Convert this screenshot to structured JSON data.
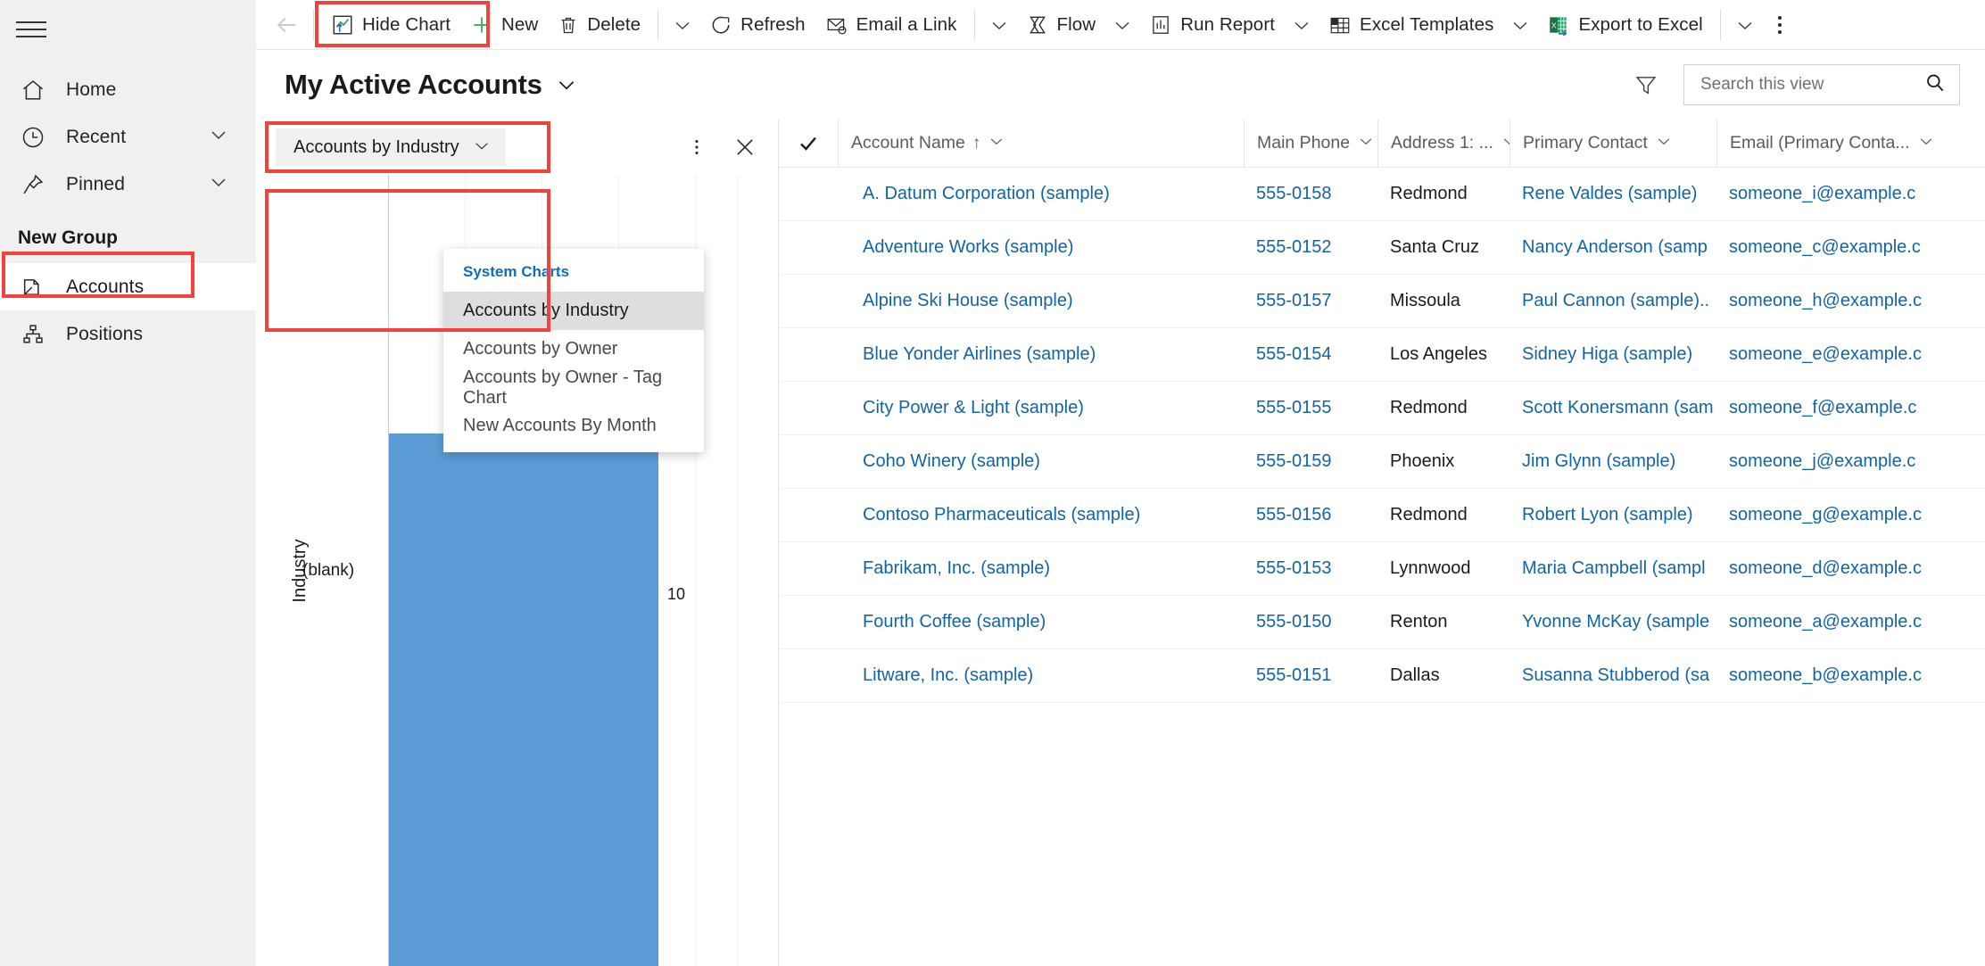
{
  "sidebar": {
    "menu_icon": "hamburger-icon",
    "items": [
      {
        "label": "Home",
        "icon": "home-icon",
        "chevron": false
      },
      {
        "label": "Recent",
        "icon": "clock-icon",
        "chevron": true
      },
      {
        "label": "Pinned",
        "icon": "pin-icon",
        "chevron": true
      }
    ],
    "group_title": "New Group",
    "group_items": [
      {
        "label": "Accounts",
        "icon": "accounts-icon",
        "selected": true
      },
      {
        "label": "Positions",
        "icon": "positions-icon",
        "selected": false
      }
    ]
  },
  "commandbar": {
    "back": "back-arrow-icon",
    "items": [
      {
        "label": "Hide Chart",
        "icon": "chart-icon",
        "chevron": false,
        "divider_after": false
      },
      {
        "label": "New",
        "icon": "plus-icon",
        "chevron": false,
        "divider_after": false
      },
      {
        "label": "Delete",
        "icon": "trash-icon",
        "chevron": true,
        "divider_after": true
      },
      {
        "label": "Refresh",
        "icon": "refresh-icon",
        "chevron": false,
        "divider_after": false
      },
      {
        "label": "Email a Link",
        "icon": "email-link-icon",
        "chevron": true,
        "divider_after": true
      },
      {
        "label": "Flow",
        "icon": "flow-icon",
        "chevron": true,
        "divider_after": false
      },
      {
        "label": "Run Report",
        "icon": "run-report-icon",
        "chevron": true,
        "divider_after": false
      },
      {
        "label": "Excel Templates",
        "icon": "excel-template-icon",
        "chevron": true,
        "divider_after": false
      },
      {
        "label": "Export to Excel",
        "icon": "export-excel-icon",
        "chevron": true,
        "divider_after": true
      }
    ],
    "overflow": "more-options-icon"
  },
  "view_header": {
    "title": "My Active Accounts",
    "filter_icon": "filter-icon",
    "search": {
      "placeholder": "Search this view",
      "value": "",
      "icon": "search-icon"
    }
  },
  "chart_panel": {
    "selector_label": "Accounts by Industry",
    "more_icon": "chart-more-icon",
    "close_icon": "close-icon",
    "menu": {
      "section_label": "System Charts",
      "items": [
        {
          "label": "Accounts by Industry",
          "active": true
        },
        {
          "label": "Accounts by Owner",
          "active": false
        },
        {
          "label": "Accounts by Owner - Tag Chart",
          "active": false
        },
        {
          "label": "New Accounts By Month",
          "active": false
        }
      ]
    }
  },
  "chart_data": {
    "type": "bar",
    "orientation": "vertical",
    "title": "Accounts by Industry",
    "categories": [
      "(blank)"
    ],
    "values": [
      10
    ],
    "data_labels": [
      "10"
    ],
    "xlabel": "",
    "ylabel": "Industry",
    "grid": true,
    "legend": "none",
    "colors": {
      "bar": "#5b9bd5"
    }
  },
  "grid": {
    "select_all_icon": "check-icon",
    "columns": [
      {
        "label": "Account Name",
        "sorted": "asc",
        "chevron": true
      },
      {
        "label": "Main Phone",
        "sorted": "",
        "chevron": true
      },
      {
        "label": "Address 1: ...",
        "sorted": "",
        "chevron": true
      },
      {
        "label": "Primary Contact",
        "sorted": "",
        "chevron": true
      },
      {
        "label": "Email (Primary Conta...",
        "sorted": "",
        "chevron": true
      }
    ],
    "rows": [
      {
        "name": "A. Datum Corporation (sample)",
        "phone": "555-0158",
        "city": "Redmond",
        "contact": "Rene Valdes (sample)",
        "email": "someone_i@example.c"
      },
      {
        "name": "Adventure Works (sample)",
        "phone": "555-0152",
        "city": "Santa Cruz",
        "contact": "Nancy Anderson (samp",
        "email": "someone_c@example.c"
      },
      {
        "name": "Alpine Ski House (sample)",
        "phone": "555-0157",
        "city": "Missoula",
        "contact": "Paul Cannon (sample)..",
        "email": "someone_h@example.c"
      },
      {
        "name": "Blue Yonder Airlines (sample)",
        "phone": "555-0154",
        "city": "Los Angeles",
        "contact": "Sidney Higa (sample)",
        "email": "someone_e@example.c"
      },
      {
        "name": "City Power & Light (sample)",
        "phone": "555-0155",
        "city": "Redmond",
        "contact": "Scott Konersmann (sam",
        "email": "someone_f@example.c"
      },
      {
        "name": "Coho Winery (sample)",
        "phone": "555-0159",
        "city": "Phoenix",
        "contact": "Jim Glynn (sample)",
        "email": "someone_j@example.c"
      },
      {
        "name": "Contoso Pharmaceuticals (sample)",
        "phone": "555-0156",
        "city": "Redmond",
        "contact": "Robert Lyon (sample)",
        "email": "someone_g@example.c"
      },
      {
        "name": "Fabrikam, Inc. (sample)",
        "phone": "555-0153",
        "city": "Lynnwood",
        "contact": "Maria Campbell (sampl",
        "email": "someone_d@example.c"
      },
      {
        "name": "Fourth Coffee (sample)",
        "phone": "555-0150",
        "city": "Renton",
        "contact": "Yvonne McKay (sample",
        "email": "someone_a@example.c"
      },
      {
        "name": "Litware, Inc. (sample)",
        "phone": "555-0151",
        "city": "Dallas",
        "contact": "Susanna Stubberod (sa",
        "email": "someone_b@example.c"
      }
    ]
  },
  "highlights": {
    "color": "#f1423b",
    "boxes": [
      "hide-chart-command",
      "accounts-nav-item",
      "chart-selector",
      "chart-menu-items"
    ]
  }
}
